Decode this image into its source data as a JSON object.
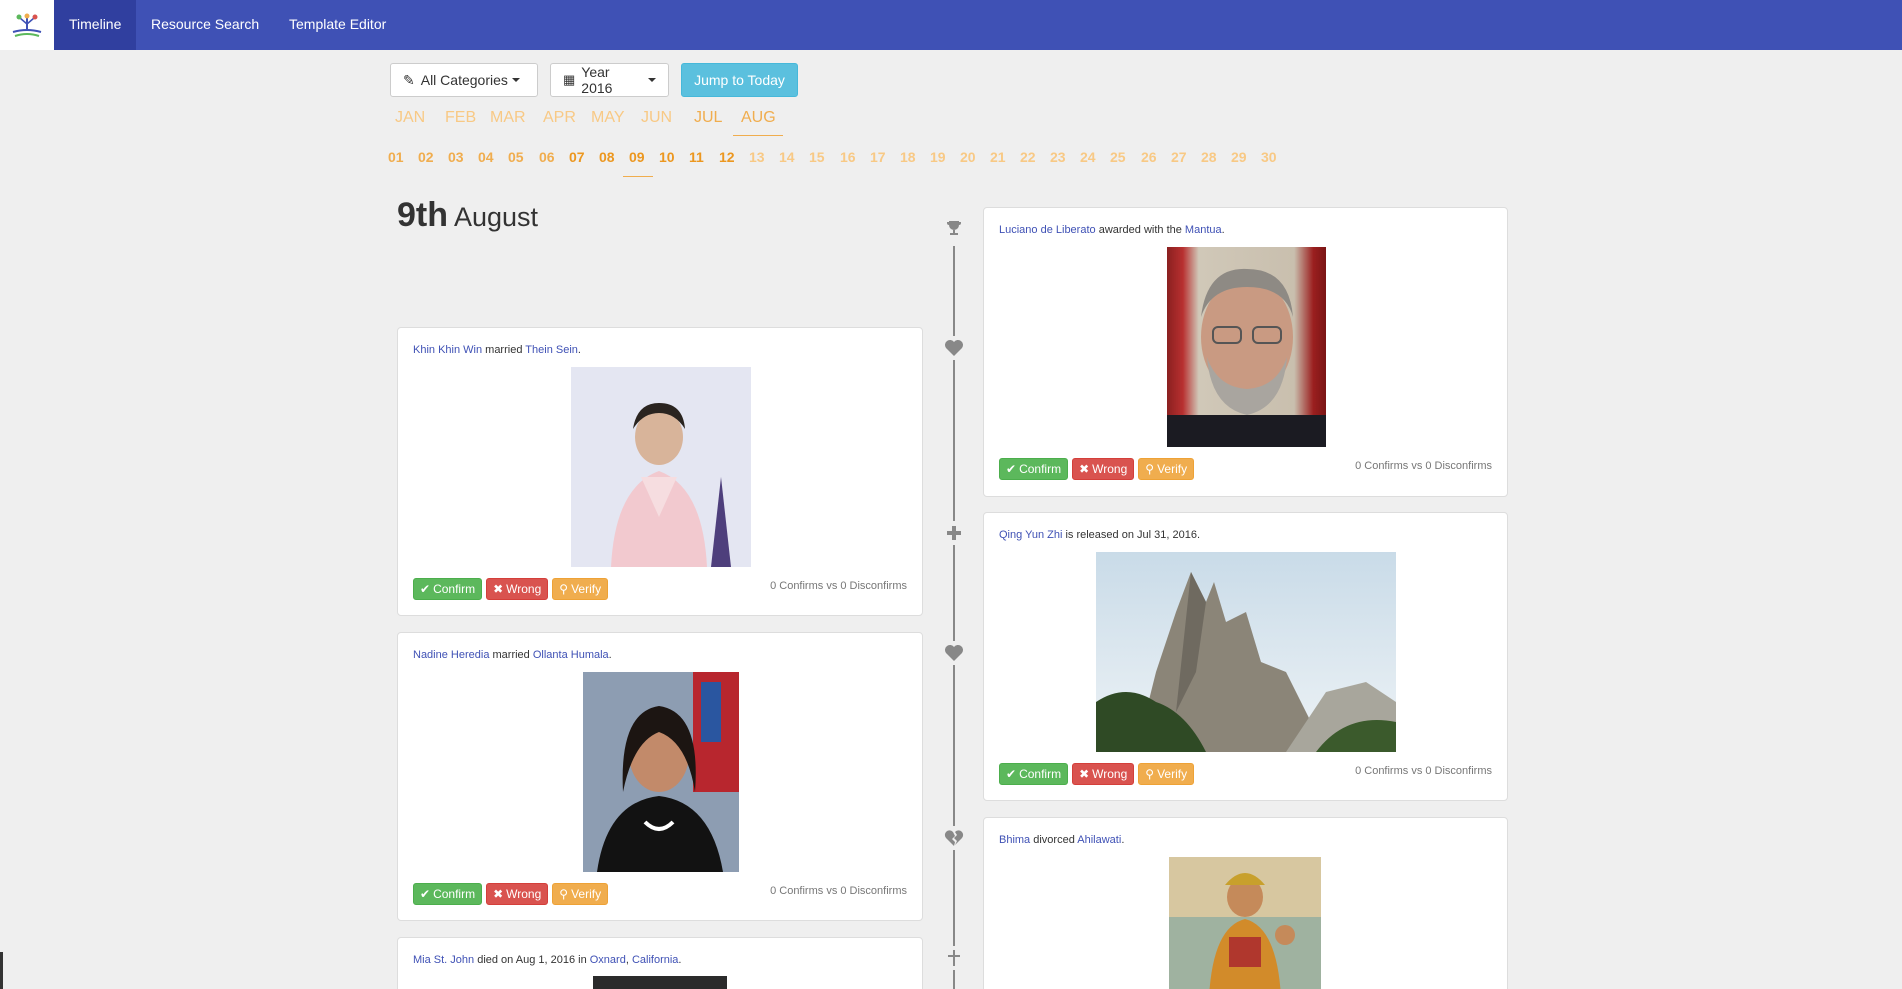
{
  "nav": {
    "items": [
      {
        "label": "Timeline"
      },
      {
        "label": "Resource Search"
      },
      {
        "label": "Template Editor"
      }
    ]
  },
  "toolbar": {
    "categories_label": "All Categories",
    "year_label": "Year 2016",
    "today_label": "Jump to Today"
  },
  "months": [
    "JAN",
    "FEB",
    "MAR",
    "APR",
    "MAY",
    "JUN",
    "JUL",
    "AUG"
  ],
  "active_month": "AUG",
  "days": [
    "01",
    "02",
    "03",
    "04",
    "05",
    "06",
    "07",
    "08",
    "09",
    "10",
    "11",
    "12",
    "13",
    "14",
    "15",
    "16",
    "17",
    "18",
    "19",
    "20",
    "21",
    "22",
    "23",
    "24",
    "25",
    "26",
    "27",
    "28",
    "29",
    "30"
  ],
  "active_day": "09",
  "heading": {
    "day": "9th",
    "month": "August"
  },
  "cards": [
    {
      "p1": "Luciano de Liberato",
      "mid": " awarded with the ",
      "p2": "Mantua",
      "end": ".",
      "score": "0 Confirms vs 0 Disconfirms"
    },
    {
      "p1": "Khin Khin Win",
      "mid": " married ",
      "p2": "Thein Sein",
      "end": ".",
      "score": "0 Confirms vs 0 Disconfirms"
    },
    {
      "p1": "Qing Yun Zhi",
      "mid": " is released on Jul 31, 2016.",
      "p2": "",
      "end": "",
      "score": "0 Confirms vs 0 Disconfirms"
    },
    {
      "p1": "Nadine Heredia",
      "mid": " married ",
      "p2": "Ollanta Humala",
      "end": ".",
      "score": "0 Confirms vs 0 Disconfirms"
    },
    {
      "p1": "Bhima",
      "mid": " divorced ",
      "p2": "Ahilawati",
      "end": ".",
      "score": ""
    },
    {
      "p1": "Mia St. John",
      "mid": " died on Aug 1, 2016 in ",
      "p2": "Oxnard",
      "sep": ", ",
      "p3": "California",
      "end": ".",
      "score": ""
    }
  ],
  "actions": {
    "confirm": "Confirm",
    "wrong": "Wrong",
    "verify": "Verify"
  },
  "icons": {
    "award": "trophy-icon",
    "marriage": "heart-icon",
    "release": "plus-icon",
    "divorce": "broken-heart-icon",
    "death": "cross-icon"
  },
  "colors": {
    "navbar": "#3f51b5",
    "accent": "#f0ad4e",
    "confirm": "#5cb85c",
    "wrong": "#d9534f",
    "verify": "#f0ad4e"
  }
}
